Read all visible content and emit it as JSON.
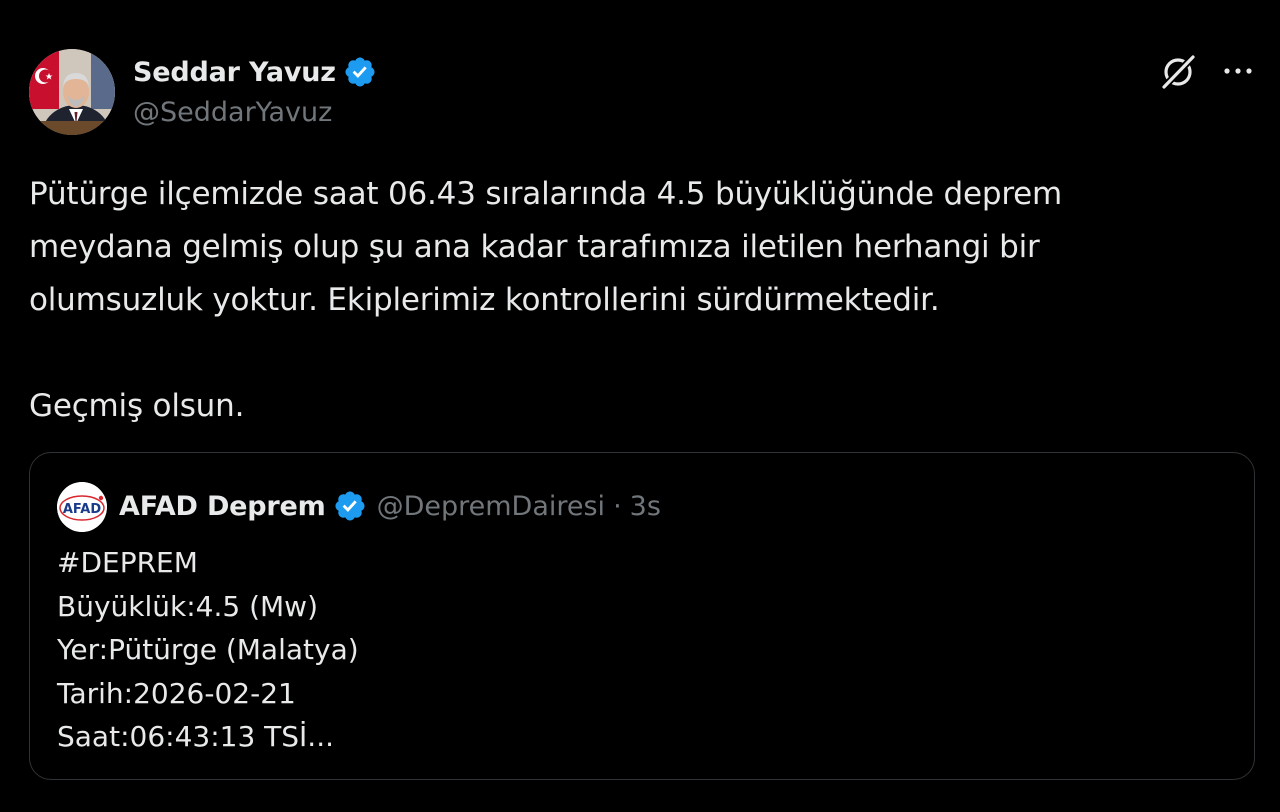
{
  "author": {
    "display_name": "Seddar Yavuz",
    "handle": "@SeddarYavuz",
    "verified": true,
    "avatar_icon": "profile-photo"
  },
  "actions": {
    "grok_icon": "grok-icon",
    "more_icon": "more-options-icon",
    "more_label": "···"
  },
  "tweet": {
    "line1": "Pütürge ilçemizde saat 06.43 sıralarında 4.5 büyüklüğünde deprem",
    "line2": "meydana gelmiş olup şu ana kadar tarafımıza iletilen herhangi bir",
    "line3": "olumsuzluk yoktur. Ekiplerimiz kontrollerini sürdürmektedir.",
    "line4": "Geçmiş olsun."
  },
  "quoted": {
    "display_name": "AFAD Deprem",
    "handle": "@DepremDairesi",
    "separator": "·",
    "time": "3s",
    "verified": true,
    "avatar_text": "AFAD",
    "lines": [
      "#DEPREM",
      "Büyüklük:4.5 (Mw)",
      "Yer:Pütürge (Malatya)",
      "Tarih:2026-02-21",
      "Saat:06:43:13 TSİ..."
    ]
  },
  "colors": {
    "background": "#000000",
    "text_primary": "#e7e9ea",
    "text_secondary": "#71767b",
    "verified_blue": "#1d9bf0",
    "border": "#2f3336",
    "afad_red": "#d8262f"
  }
}
